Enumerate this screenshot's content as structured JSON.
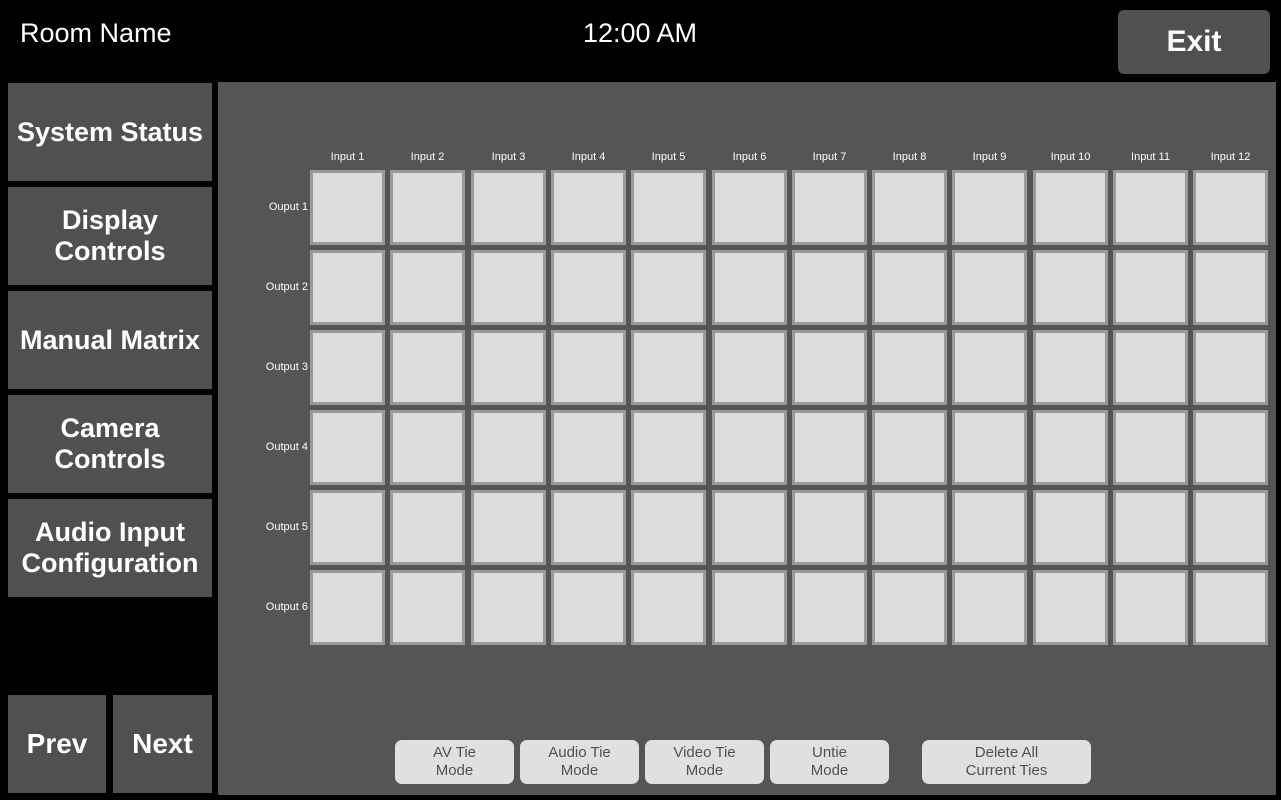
{
  "header": {
    "room_name": "Room Name",
    "time": "12:00 AM",
    "exit_label": "Exit"
  },
  "sidebar": {
    "items": [
      {
        "label": "System Status"
      },
      {
        "label": "Display\nControls"
      },
      {
        "label": "Manual Matrix"
      },
      {
        "label": "Camera\nControls"
      },
      {
        "label": "Audio Input\nConfiguration"
      }
    ],
    "prev_label": "Prev",
    "next_label": "Next"
  },
  "matrix": {
    "inputs": [
      "Input 1",
      "Input 2",
      "Input 3",
      "Input 4",
      "Input 5",
      "Input 6",
      "Input 7",
      "Input 8",
      "Input 9",
      "Input 10",
      "Input 11",
      "Input 12"
    ],
    "outputs": [
      "Ouput 1",
      "Output 2",
      "Output 3",
      "Output 4",
      "Output 5",
      "Output 6"
    ]
  },
  "mode_buttons": {
    "av_tie": "AV Tie\nMode",
    "audio_tie": "Audio Tie\nMode",
    "video_tie": "Video Tie\nMode",
    "untie": "Untie\nMode",
    "delete_all": "Delete All\nCurrent Ties"
  },
  "colors": {
    "background": "#000000",
    "panel": "#555555",
    "button": "#505050",
    "cell": "#dcdcdc",
    "cell_border": "#9a9a9a",
    "mode_button": "#e0e0e0",
    "mode_button_text": "#505050"
  }
}
